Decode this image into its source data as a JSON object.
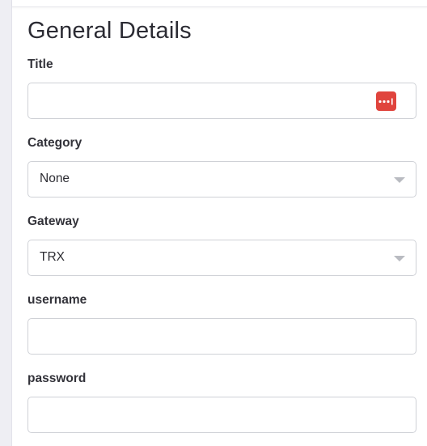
{
  "section": {
    "title": "General Details"
  },
  "fields": {
    "title": {
      "label": "Title",
      "value": "",
      "icon": "password-manager-icon",
      "icon_color": "#e0443d"
    },
    "category": {
      "label": "Category",
      "value": "None",
      "icon": "chevron-down-icon"
    },
    "gateway": {
      "label": "Gateway",
      "value": "TRX",
      "icon": "chevron-down-icon"
    },
    "username": {
      "label": "username",
      "value": ""
    },
    "password": {
      "label": "password",
      "value": ""
    }
  }
}
